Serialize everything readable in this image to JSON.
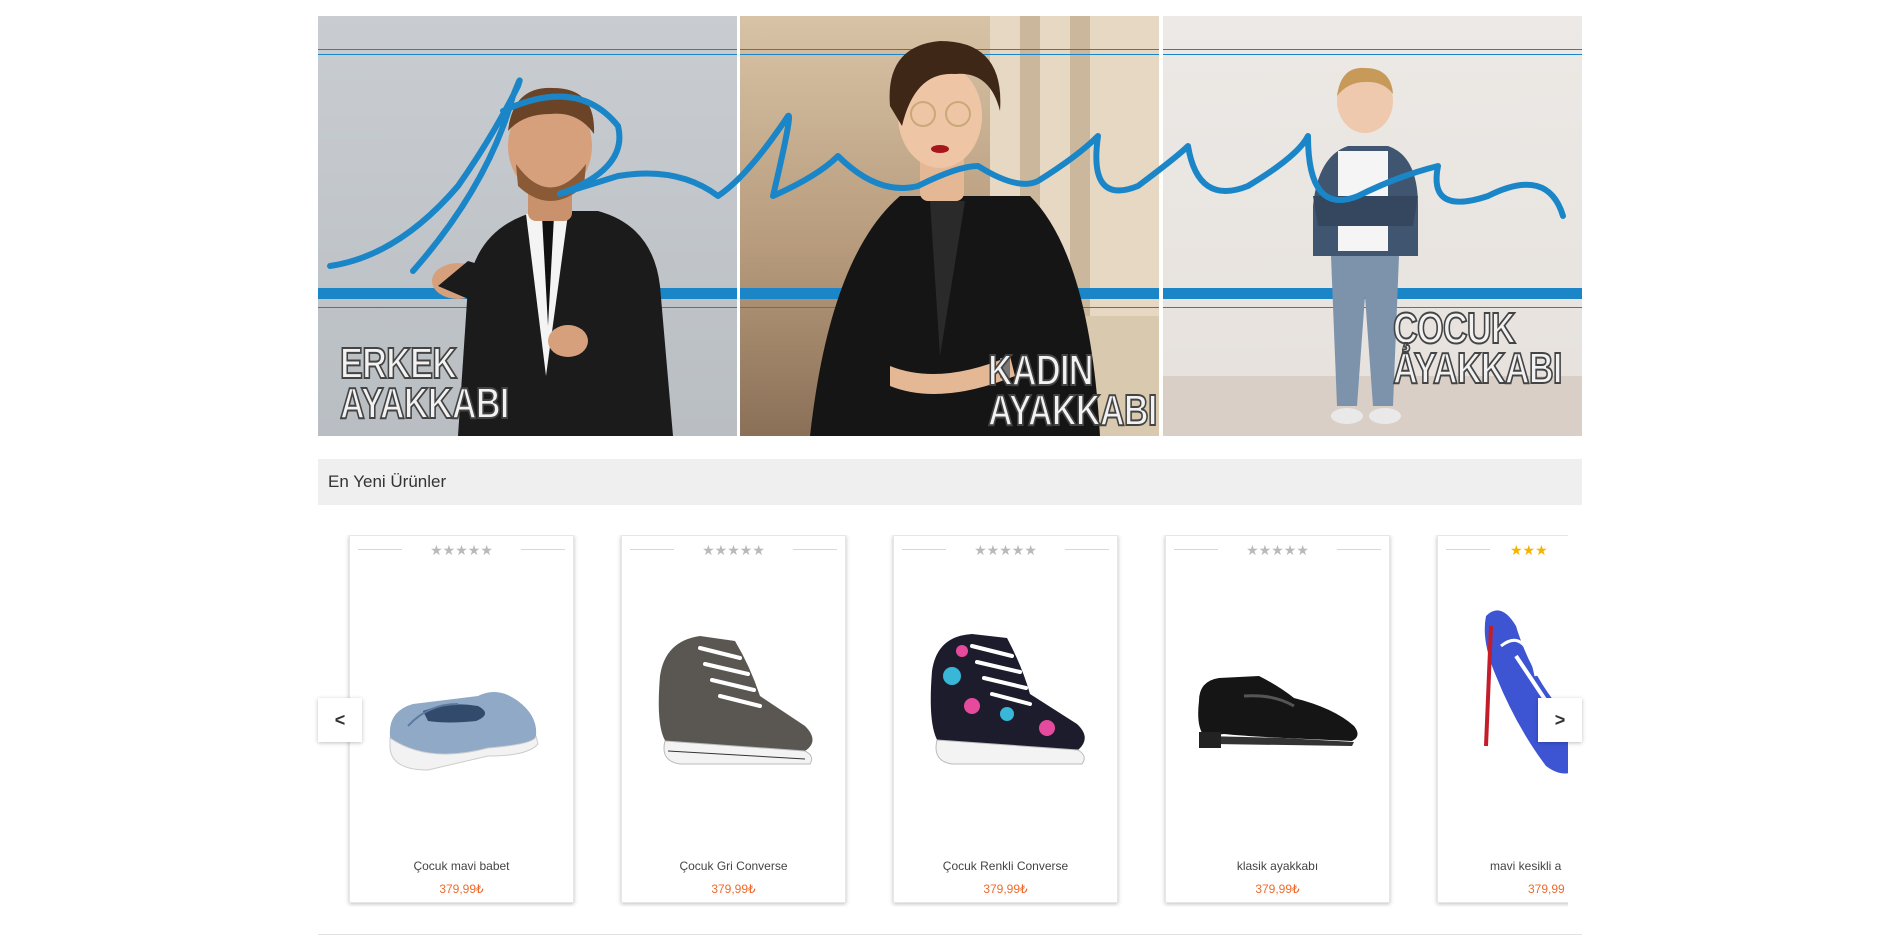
{
  "hero": {
    "categories": [
      {
        "label_line1": "ERKEK",
        "label_line2": "AYAKKABI"
      },
      {
        "label_line1": "KADIN",
        "label_line2": "AYAKKABI"
      },
      {
        "label_line1": "ÇOCUK",
        "label_line2": "AYAKKABI"
      }
    ],
    "accent_color": "#1a86c8"
  },
  "section": {
    "title": "En Yeni Ürünler"
  },
  "carousel": {
    "prev_label": "<",
    "next_label": ">",
    "products": [
      {
        "name": "Çocuk mavi babet",
        "price": "379,99₺",
        "stars": "★★★★★",
        "rating": 0
      },
      {
        "name": "Çocuk Gri Converse",
        "price": "379,99₺",
        "stars": "★★★★★",
        "rating": 0
      },
      {
        "name": "Çocuk Renkli Converse",
        "price": "379,99₺",
        "stars": "★★★★★",
        "rating": 0
      },
      {
        "name": "klasik ayakkabı",
        "price": "379,99₺",
        "stars": "★★★★★",
        "rating": 0
      },
      {
        "name": "mavi kesikli a",
        "price": "379,99",
        "stars": "★★★",
        "rating": 3
      }
    ],
    "price_color": "#ee6b2d"
  }
}
